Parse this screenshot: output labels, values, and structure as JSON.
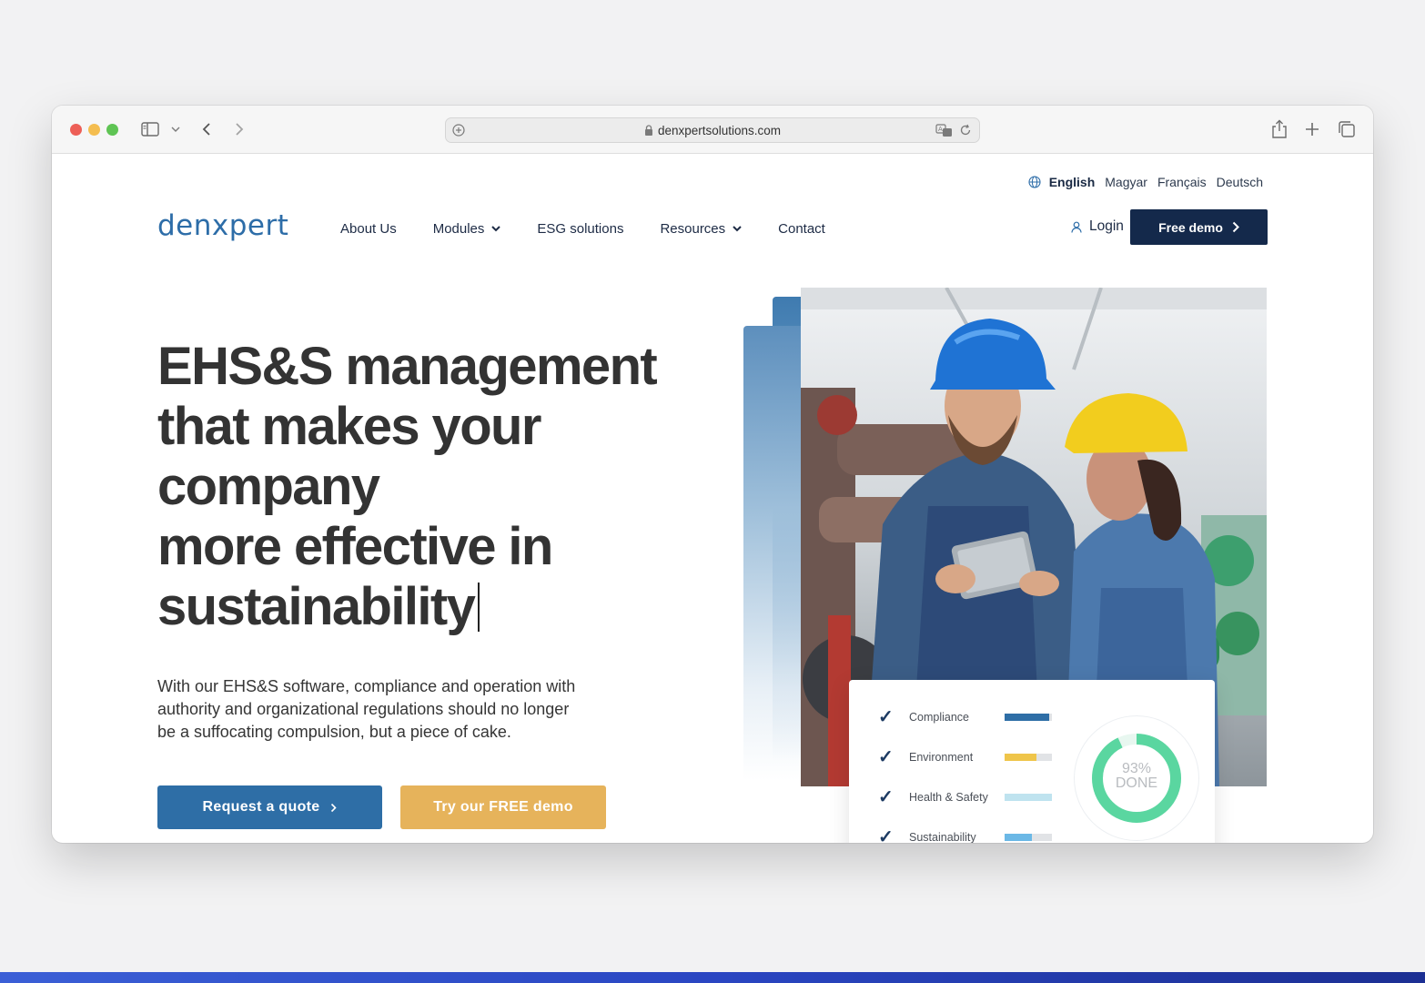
{
  "browser": {
    "url": "denxpertsolutions.com"
  },
  "lang": {
    "items": [
      "English",
      "Magyar",
      "Français",
      "Deutsch"
    ]
  },
  "brand": {
    "logo": "denxpert",
    "primary": "#2d6da8",
    "dark": "#14294b",
    "accent": "#e6b35b"
  },
  "nav": {
    "items": [
      "About Us",
      "Modules",
      "ESG solutions",
      "Resources",
      "Contact"
    ]
  },
  "header": {
    "login": "Login",
    "free_demo": "Free demo"
  },
  "hero": {
    "line1": "EHS&S management",
    "line2": "that makes your",
    "line3": "company",
    "line4": "more effective in",
    "line5": "sustainability",
    "description": "With our EHS&S software, compliance and operation with authority and organizational regulations should no longer be a suffocating compulsion, but a piece of cake.",
    "quote_button": "Request a quote",
    "demo_button": "Try our FREE demo"
  },
  "dashboard": {
    "rows": [
      {
        "label": "Compliance",
        "progress": 0.95,
        "color": "#2e6ea6"
      },
      {
        "label": "Environment",
        "progress": 0.68,
        "color": "#efc54a"
      },
      {
        "label": "Health & Safety",
        "progress": 1.0,
        "color": "#bfe3ef"
      },
      {
        "label": "Sustainability",
        "progress": 0.58,
        "color": "#6bb8e6"
      }
    ],
    "done_value": "93%",
    "done_label": "DONE",
    "done_fraction": 0.93,
    "done_color": "#5ad6a0"
  }
}
